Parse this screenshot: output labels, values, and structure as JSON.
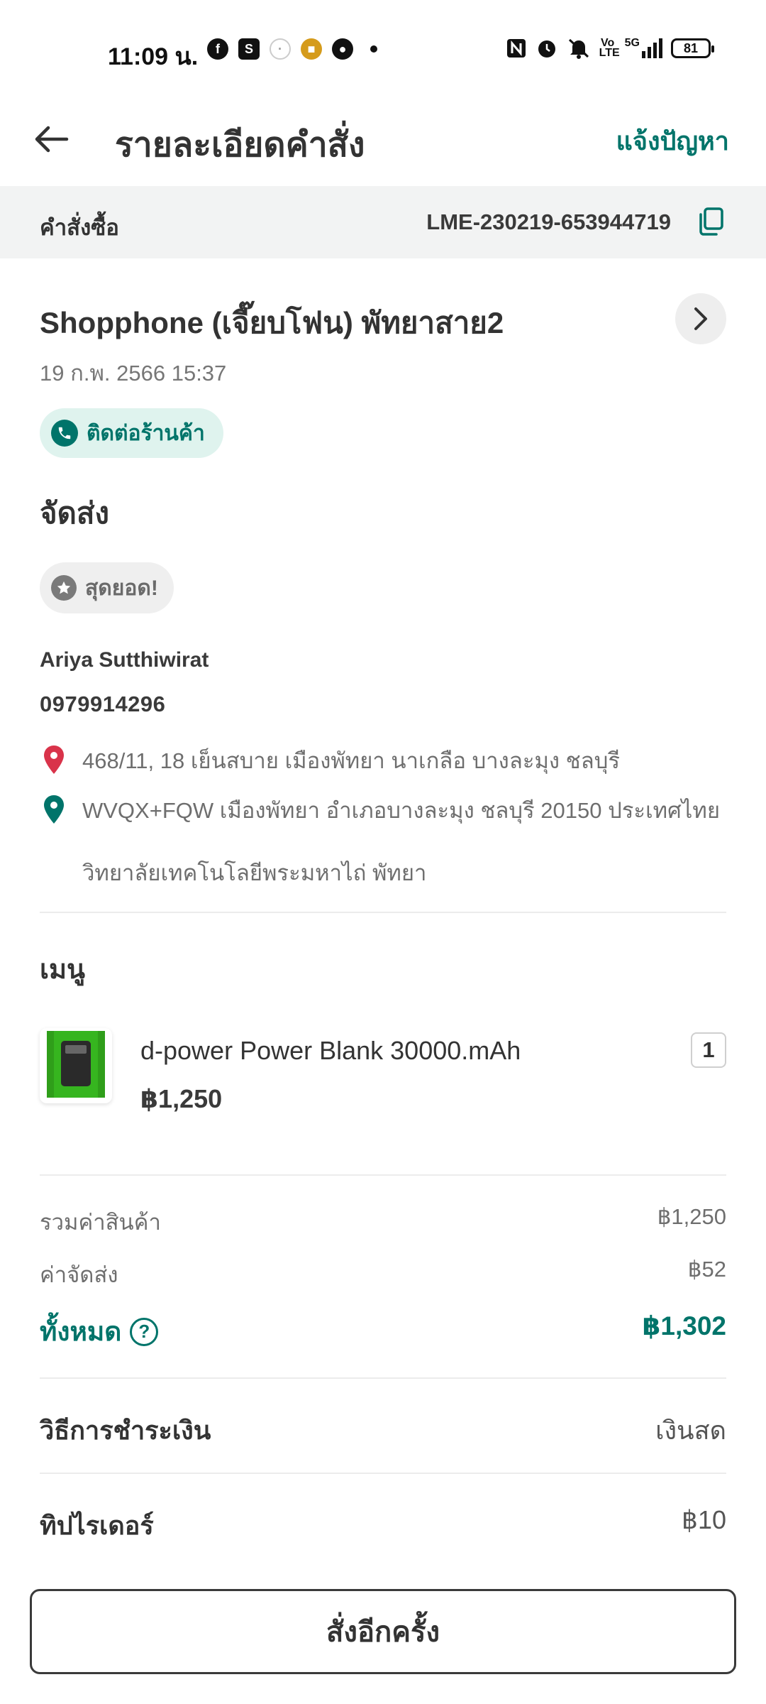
{
  "status_bar": {
    "time": "11:09 น.",
    "left_icons": [
      "facebook-icon",
      "shopping-bag-icon",
      "ghost-icon",
      "lineman-icon",
      "reddit-icon",
      "dot-icon"
    ],
    "right_icons": [
      "nfc-icon",
      "alarm-icon",
      "mute-icon",
      "volte-icon",
      "5g-signal-icon"
    ],
    "volte": "Vo LTE",
    "network": "5G",
    "battery": "81"
  },
  "header": {
    "title": "รายละเอียดคำสั่ง",
    "report_link": "แจ้งปัญหา"
  },
  "order": {
    "label": "คำสั่งซื้อ",
    "id": "LME-230219-653944719"
  },
  "store": {
    "name": "Shopphone (เจี๊ยบโฟน) พัทยาสาย2",
    "date": "19 ก.พ. 2566 15:37",
    "contact_label": "ติดต่อร้านค้า"
  },
  "delivery": {
    "title": "จัดส่ง",
    "badge": "สุดยอด!",
    "customer_name": "Ariya Sutthiwirat",
    "customer_phone": "0979914296",
    "pickup_address": "468/11, 18 เย็นสบาย เมืองพัทยา นาเกลือ บางละมุง ชลบุรี",
    "dropoff_address": "WVQX+FQW เมืองพัทยา อำเภอบางละมุง ชลบุรี 20150 ประเทศไทย",
    "dropoff_note": "วิทยาลัยเทคโนโลยีพระมหาไถ่ พัทยา",
    "pickup_pin_color": "#d9334a",
    "dropoff_pin_color": "#00746a"
  },
  "menu": {
    "title": "เมนู",
    "items": [
      {
        "name": "d-power Power Blank 30000.mAh",
        "price": "฿1,250",
        "qty": "1"
      }
    ]
  },
  "summary": {
    "subtotal_label": "รวมค่าสินค้า",
    "subtotal": "฿1,250",
    "delivery_fee_label": "ค่าจัดส่ง",
    "delivery_fee": "฿52",
    "total_label": "ทั้งหมด",
    "total": "฿1,302"
  },
  "payment": {
    "label": "วิธีการชำระเงิน",
    "value": "เงินสด"
  },
  "tip": {
    "label": "ทิปไรเดอร์",
    "value": "฿10"
  },
  "reorder_button": "สั่งอีกครั้ง",
  "colors": {
    "accent": "#00746a",
    "chip_bg": "#dff3ee"
  }
}
